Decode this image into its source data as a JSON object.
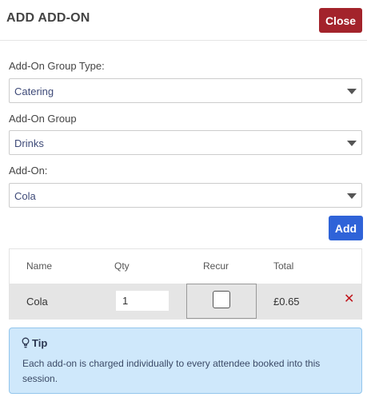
{
  "dialog": {
    "title": "ADD ADD-ON",
    "close_label": "Close"
  },
  "fields": {
    "group_type": {
      "label": "Add-On Group Type:",
      "value": "Catering"
    },
    "group": {
      "label": "Add-On Group",
      "value": "Drinks"
    },
    "addon": {
      "label": "Add-On:",
      "value": "Cola"
    }
  },
  "add_label": "Add",
  "table": {
    "headers": {
      "name": "Name",
      "qty": "Qty",
      "recur": "Recur",
      "total": "Total"
    },
    "rows": [
      {
        "name": "Cola",
        "qty": "1",
        "recur": false,
        "total": "£0.65",
        "remove_icon": "remove-x-icon"
      }
    ]
  },
  "tip": {
    "icon": "lightbulb-icon",
    "heading": "Tip",
    "text": "Each add-on is charged individually to every attendee booked into this session."
  },
  "colors": {
    "close_button": "#a3232b",
    "add_button": "#2f63d8",
    "remove_icon": "#c0141b",
    "tip_background": "#cfe8fb"
  }
}
